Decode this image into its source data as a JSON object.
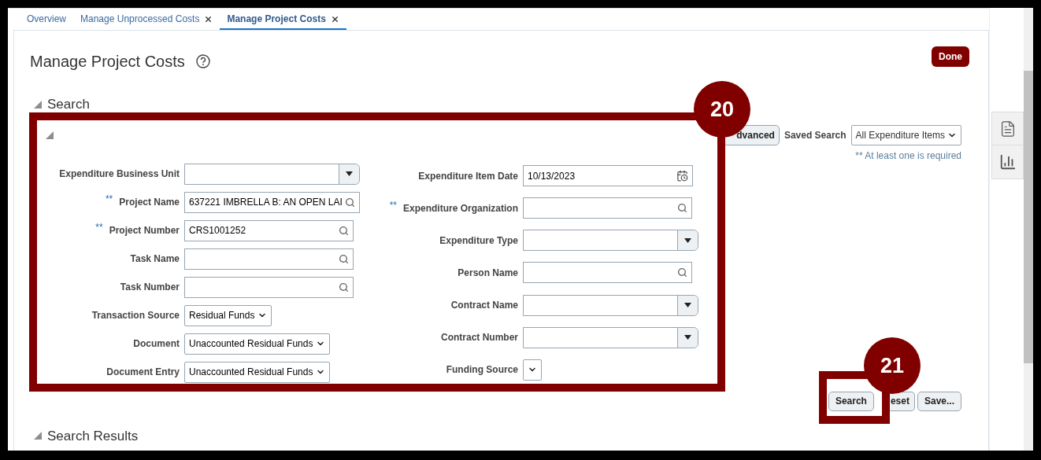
{
  "tabs": [
    {
      "label": "Overview",
      "selected": false,
      "closable": false
    },
    {
      "label": "Manage Unprocessed Costs",
      "selected": false,
      "closable": true
    },
    {
      "label": "Manage Project Costs",
      "selected": true,
      "closable": true
    }
  ],
  "page": {
    "title": "Manage Project Costs",
    "done_button": "Done"
  },
  "search": {
    "title": "Search",
    "expanded": true,
    "form_expanded": true,
    "advanced_button": "dvanced",
    "saved_search": {
      "label": "Saved Search",
      "value": "All Expenditure Items"
    },
    "required_note": "** At least one is required",
    "fields_left": [
      {
        "label": "Expenditure Business Unit",
        "kind": "combo"
      },
      {
        "label": "Project Name",
        "kind": "lookup",
        "required_mark": "**",
        "value": "637221 IMBRELLA B: AN OPEN LAI"
      },
      {
        "label": "Project Number",
        "kind": "lookup",
        "required_mark": "**",
        "value": "CRS1001252"
      },
      {
        "label": "Task Name",
        "kind": "lookup"
      },
      {
        "label": "Task Number",
        "kind": "lookup"
      },
      {
        "label": "Transaction Source",
        "kind": "select",
        "value": "Residual Funds"
      },
      {
        "label": "Document",
        "kind": "select",
        "value": "Unaccounted Residual Funds"
      },
      {
        "label": "Document Entry",
        "kind": "select",
        "value": "Unaccounted Residual Funds"
      }
    ],
    "fields_right": [
      {
        "label": "Expenditure Item Date",
        "kind": "date",
        "value": "10/13/2023"
      },
      {
        "label": "Expenditure Organization",
        "kind": "lookup",
        "required_mark": "**"
      },
      {
        "label": "Expenditure Type",
        "kind": "combo"
      },
      {
        "label": "Person Name",
        "kind": "lookup"
      },
      {
        "label": "Contract Name",
        "kind": "combo"
      },
      {
        "label": "Contract Number",
        "kind": "combo"
      },
      {
        "label": "Funding Source",
        "kind": "select"
      }
    ],
    "buttons": [
      "Search",
      "eset",
      "Save..."
    ]
  },
  "results": {
    "title": "Search Results",
    "expanded": true
  },
  "annotations": [
    {
      "kind": "form",
      "number": "20"
    },
    {
      "kind": "button",
      "number": "21"
    }
  ]
}
